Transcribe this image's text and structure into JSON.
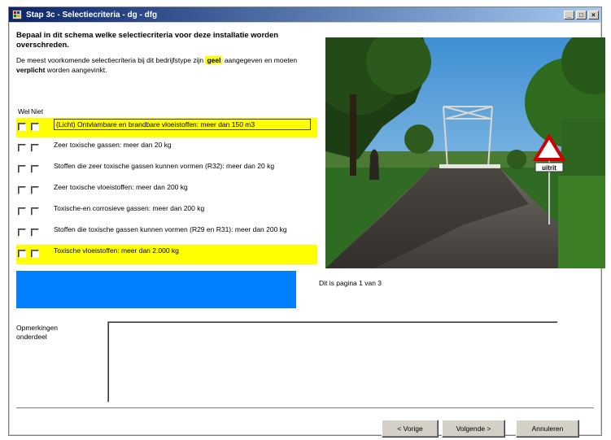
{
  "window": {
    "title": "Stap 3c - Selectiecriteria - dg - dfg",
    "controls": {
      "minimize": "_",
      "maximize": "□",
      "close": "×"
    }
  },
  "main": {
    "heading": "Bepaal in dit schema welke selectiecriteria voor deze installatie worden overschreden.",
    "intro_part1": "De meest voorkomende selectiecriteria bij dit bedrijfstype zijn ",
    "intro_highlight": "geel",
    "intro_part2": " aangegeven en moeten ",
    "intro_bold": "verplicht",
    "intro_part3": " worden aangevinkt.",
    "column_wel": "Wel",
    "column_niet": "Niet",
    "criteria": [
      {
        "label": "(Licht) Ontvlambare en brandbare vloeistoffen: meer dan 150 m3",
        "highlighted": true
      },
      {
        "label": "Zeer toxische gassen: meer dan 20 kg",
        "highlighted": false
      },
      {
        "label": "Stoffen die zeer toxische gassen kunnen vormen (R32): meer dan 20 kg",
        "highlighted": false
      },
      {
        "label": "Zeer toxische vloeistoffen: meer dan 200 kg",
        "highlighted": false
      },
      {
        "label": "Toxische-en corrosieve gassen: meer dan 200 kg",
        "highlighted": false
      },
      {
        "label": "Stoffen die toxische gassen kunnen vormen (R29 en R31): meer dan 200 kg",
        "highlighted": false
      },
      {
        "label": "Toxische vloeistoffen: meer dan 2.000 kg",
        "highlighted": true
      }
    ],
    "page_info": "Dit is pagina 1 van 3",
    "sign_text": "uitrit",
    "remarks_label": "Opmerkingen onderdeel",
    "remarks_value": ""
  },
  "footer": {
    "prev": "< Vorige",
    "next": "Volgende >",
    "cancel": "Annuleren"
  },
  "colors": {
    "highlight": "#ffff00",
    "blue_panel": "#0080ff",
    "titlebar": "#0a246a"
  }
}
